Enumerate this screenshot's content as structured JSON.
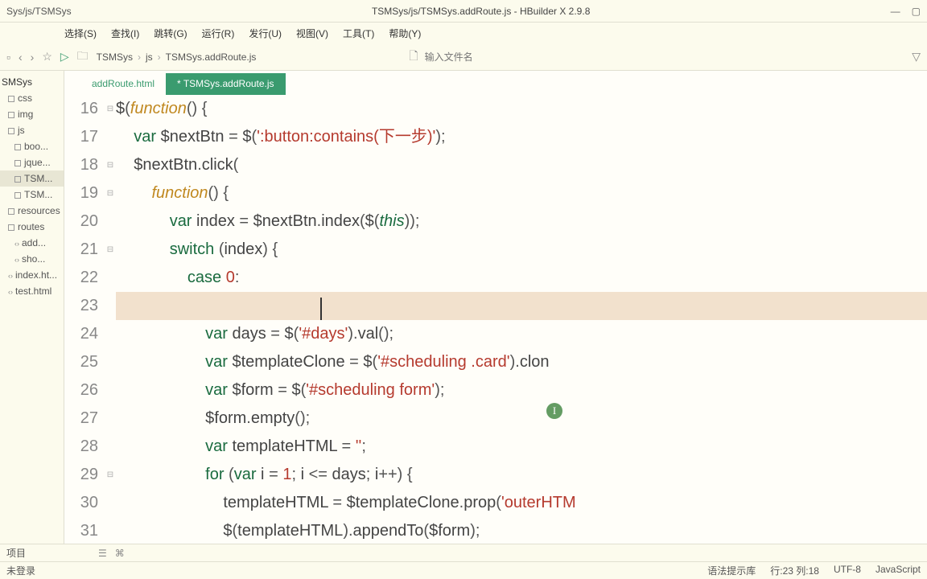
{
  "titlebar": {
    "path": "Sys/js/TSMSys",
    "title": "TSMSys/js/TSMSys.addRoute.js - HBuilder X 2.9.8"
  },
  "menubar": [
    "选择(S)",
    "查找(I)",
    "跳转(G)",
    "运行(R)",
    "发行(U)",
    "视图(V)",
    "工具(T)",
    "帮助(Y)"
  ],
  "breadcrumb": [
    "TSMSys",
    "js",
    "TSMSys.addRoute.js"
  ],
  "search_placeholder": "输入文件名",
  "sidebar": {
    "root": "SMSys",
    "items": [
      "css",
      "img",
      "js"
    ],
    "jsfiles": [
      "boo...",
      "jque...",
      "TSM...",
      "TSM..."
    ],
    "items2": [
      "resources",
      "routes"
    ],
    "routefiles": [
      "add...",
      "sho..."
    ],
    "files": [
      "index.ht...",
      "test.html"
    ]
  },
  "tabs": [
    {
      "label": "addRoute.html",
      "active": false
    },
    {
      "label": "* TSMSys.addRoute.js",
      "active": true
    }
  ],
  "gutter_start": 16,
  "gutter_end": 31,
  "fold_markers": {
    "16": "⊟",
    "18": "⊟",
    "19": "⊟",
    "21": "⊟",
    "29": "⊟"
  },
  "code_lines": {
    "16": [
      [
        "jq",
        "$"
      ],
      [
        "paren",
        "("
      ],
      [
        "fn",
        "function"
      ],
      [
        "paren",
        "() {"
      ]
    ],
    "17": [
      [
        "sp",
        "    "
      ],
      [
        "kw",
        "var"
      ],
      [
        "jq",
        " $nextBtn "
      ],
      [
        "punc",
        "= "
      ],
      [
        "jq",
        "$"
      ],
      [
        "paren",
        "("
      ],
      [
        "str",
        "':button:contains(下一步)'"
      ],
      [
        "paren",
        ")"
      ],
      [
        "punc",
        ";"
      ]
    ],
    "18": [
      [
        "sp",
        "    "
      ],
      [
        "jq",
        "$nextBtn"
      ],
      [
        "punc",
        "."
      ],
      [
        "jq",
        "click"
      ],
      [
        "paren",
        "("
      ]
    ],
    "19": [
      [
        "sp",
        "        "
      ],
      [
        "fn",
        "function"
      ],
      [
        "paren",
        "() {"
      ]
    ],
    "20": [
      [
        "sp",
        "            "
      ],
      [
        "kw",
        "var"
      ],
      [
        "jq",
        " index "
      ],
      [
        "punc",
        "= "
      ],
      [
        "jq",
        "$nextBtn"
      ],
      [
        "punc",
        "."
      ],
      [
        "jq",
        "index"
      ],
      [
        "paren",
        "("
      ],
      [
        "jq",
        "$"
      ],
      [
        "paren",
        "("
      ],
      [
        "this",
        "this"
      ],
      [
        "paren",
        "))"
      ],
      [
        "punc",
        ";"
      ]
    ],
    "21": [
      [
        "sp",
        "            "
      ],
      [
        "kw",
        "switch"
      ],
      [
        "paren",
        " ("
      ],
      [
        "jq",
        "index"
      ],
      [
        "paren",
        ") {"
      ]
    ],
    "22": [
      [
        "sp",
        "                "
      ],
      [
        "kw",
        "case"
      ],
      [
        "jq",
        " "
      ],
      [
        "num",
        "0"
      ],
      [
        "punc",
        ":"
      ]
    ],
    "23": [
      [
        "sp",
        ""
      ]
    ],
    "24": [
      [
        "sp",
        "                    "
      ],
      [
        "kw",
        "var"
      ],
      [
        "jq",
        " days "
      ],
      [
        "punc",
        "= "
      ],
      [
        "jq",
        "$"
      ],
      [
        "paren",
        "("
      ],
      [
        "str",
        "'#days'"
      ],
      [
        "paren",
        ")"
      ],
      [
        "punc",
        "."
      ],
      [
        "jq",
        "val"
      ],
      [
        "paren",
        "()"
      ],
      [
        "punc",
        ";"
      ]
    ],
    "25": [
      [
        "sp",
        "                    "
      ],
      [
        "kw",
        "var"
      ],
      [
        "jq",
        " $templateClone "
      ],
      [
        "punc",
        "= "
      ],
      [
        "jq",
        "$"
      ],
      [
        "paren",
        "("
      ],
      [
        "str",
        "'#scheduling .card'"
      ],
      [
        "paren",
        ")"
      ],
      [
        "punc",
        "."
      ],
      [
        "jq",
        "clon"
      ]
    ],
    "26": [
      [
        "sp",
        "                    "
      ],
      [
        "kw",
        "var"
      ],
      [
        "jq",
        " $form "
      ],
      [
        "punc",
        "= "
      ],
      [
        "jq",
        "$"
      ],
      [
        "paren",
        "("
      ],
      [
        "str",
        "'#scheduling form'"
      ],
      [
        "paren",
        ")"
      ],
      [
        "punc",
        ";"
      ]
    ],
    "27": [
      [
        "sp",
        "                    "
      ],
      [
        "jq",
        "$form"
      ],
      [
        "punc",
        "."
      ],
      [
        "jq",
        "empty"
      ],
      [
        "paren",
        "()"
      ],
      [
        "punc",
        ";"
      ]
    ],
    "28": [
      [
        "sp",
        "                    "
      ],
      [
        "kw",
        "var"
      ],
      [
        "jq",
        " templateHTML "
      ],
      [
        "punc",
        "= "
      ],
      [
        "str",
        "''"
      ],
      [
        "punc",
        ";"
      ]
    ],
    "29": [
      [
        "sp",
        "                    "
      ],
      [
        "kw",
        "for"
      ],
      [
        "paren",
        " ("
      ],
      [
        "kw",
        "var"
      ],
      [
        "jq",
        " i "
      ],
      [
        "punc",
        "= "
      ],
      [
        "num",
        "1"
      ],
      [
        "punc",
        "; "
      ],
      [
        "jq",
        "i "
      ],
      [
        "punc",
        "<= "
      ],
      [
        "jq",
        "days"
      ],
      [
        "punc",
        "; "
      ],
      [
        "jq",
        "i"
      ],
      [
        "punc",
        "++"
      ],
      [
        "paren",
        ") {"
      ]
    ],
    "30": [
      [
        "sp",
        "                        "
      ],
      [
        "jq",
        "templateHTML "
      ],
      [
        "punc",
        "= "
      ],
      [
        "jq",
        "$templateClone"
      ],
      [
        "punc",
        "."
      ],
      [
        "jq",
        "prop"
      ],
      [
        "paren",
        "("
      ],
      [
        "str",
        "'outerHTM"
      ]
    ],
    "31": [
      [
        "sp",
        "                        "
      ],
      [
        "jq",
        "$"
      ],
      [
        "paren",
        "("
      ],
      [
        "jq",
        "templateHTML"
      ],
      [
        "paren",
        ")"
      ],
      [
        "punc",
        "."
      ],
      [
        "jq",
        "appendTo"
      ],
      [
        "paren",
        "("
      ],
      [
        "jq",
        "$form"
      ],
      [
        "paren",
        ")"
      ],
      [
        "punc",
        ";"
      ]
    ]
  },
  "bottombar": {
    "project": "项目",
    "login": "未登录"
  },
  "statusbar": {
    "hints": "语法提示库",
    "pos": "行:23  列:18",
    "encoding": "UTF-8",
    "lang": "JavaScript"
  }
}
